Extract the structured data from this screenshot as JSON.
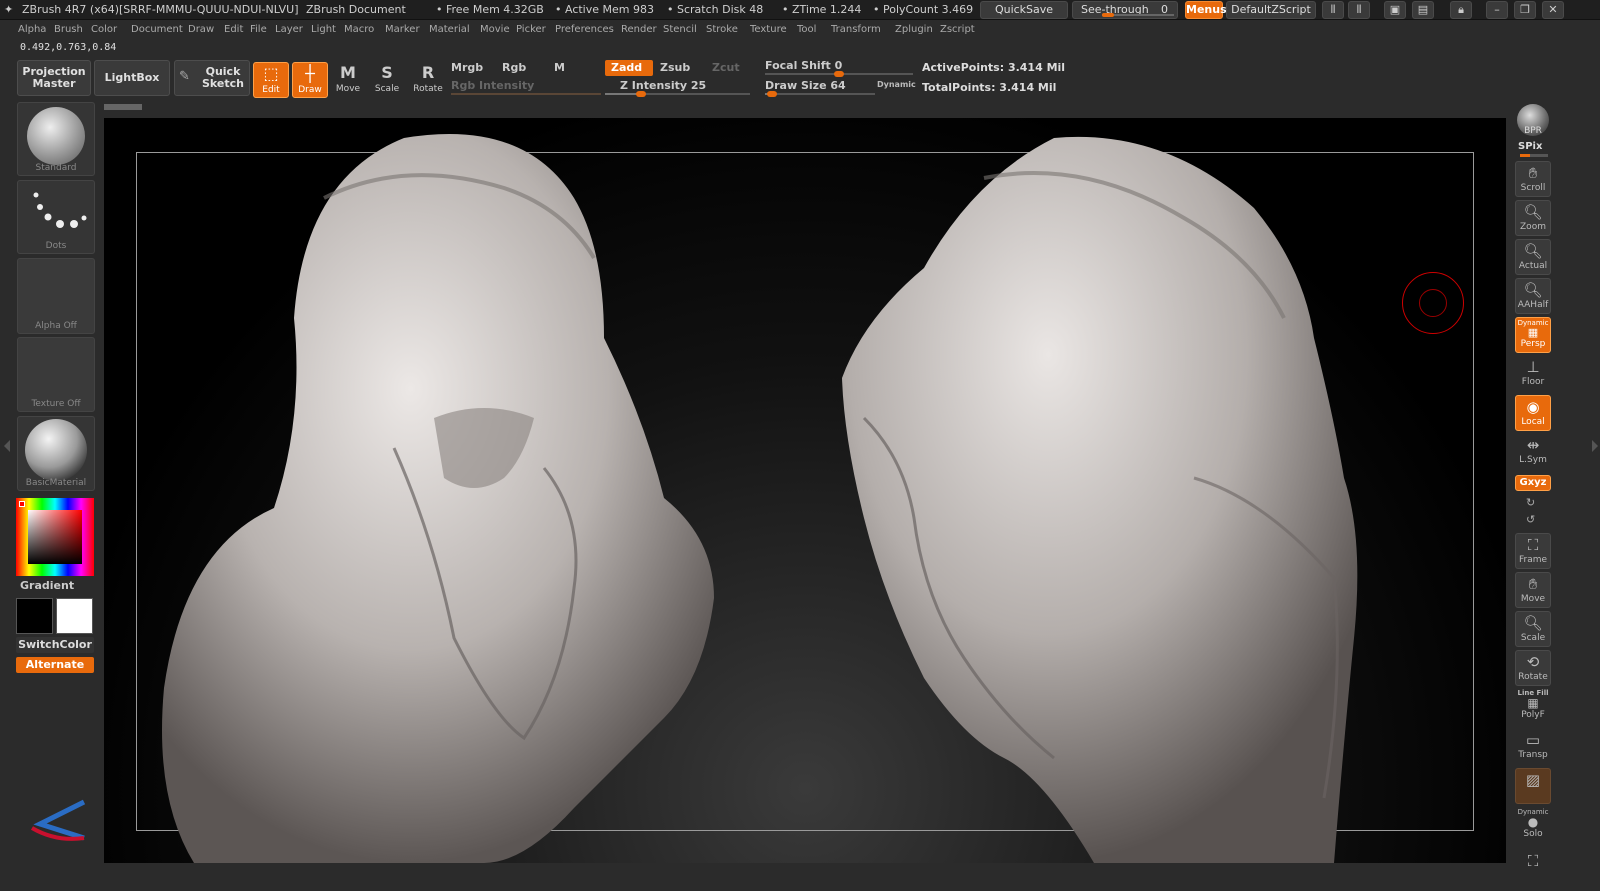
{
  "titlebar": {
    "app_title": "ZBrush 4R7 (x64)[SRRF-MMMU-QUUU-NDUI-NLVU]",
    "document": "ZBrush Document",
    "free_mem": "• Free Mem 4.32GB",
    "active_mem": "• Active Mem 983",
    "scratch": "• Scratch Disk 48",
    "ztime": "• ZTime 1.244",
    "polycount": "• PolyCount 3.469",
    "quicksave": "QuickSave",
    "see_through_label": "See-through",
    "see_through_value": "0",
    "see_through_level": 0,
    "menus": "Menus",
    "script": "DefaultZScript"
  },
  "menu": [
    "Alpha",
    "Brush",
    "Color",
    "Document",
    "Draw",
    "Edit",
    "File",
    "Layer",
    "Light",
    "Macro",
    "Marker",
    "Material",
    "Movie",
    "Picker",
    "Preferences",
    "Render",
    "Stencil",
    "Stroke",
    "Texture",
    "Tool",
    "Transform",
    "Zplugin",
    "Zscript"
  ],
  "coords": "0.492,0.763,0.84",
  "shelf": {
    "projection_master": [
      "Projection",
      "Master"
    ],
    "lightbox": "LightBox",
    "quick_sketch": [
      "Quick",
      "Sketch"
    ],
    "edit": "Edit",
    "draw": "Draw",
    "move": "Move",
    "scale": "Scale",
    "rotate": "Rotate",
    "mrgb": "Mrgb",
    "rgb": "Rgb",
    "m": "M",
    "rgb_intensity": "Rgb Intensity",
    "zadd": "Zadd",
    "zsub": "Zsub",
    "zcut": "Zcut",
    "z_intensity": "Z Intensity 25",
    "z_intensity_value": 25,
    "focal_shift": "Focal Shift 0",
    "focal_shift_value": 0,
    "draw_size": "Draw Size 64",
    "draw_size_value": 64,
    "dynamic": "Dynamic",
    "active_points": "ActivePoints: 3.414 Mil",
    "total_points": "TotalPoints: 3.414 Mil"
  },
  "left": {
    "brush": "Standard",
    "stroke": "Dots",
    "alpha": "Alpha  Off",
    "texture": "Texture  Off",
    "material": "BasicMaterial",
    "gradient": "Gradient",
    "switch_color": "SwitchColor",
    "alternate": "Alternate"
  },
  "right": {
    "bpr": "BPR",
    "spix": "SPix",
    "scroll": "Scroll",
    "zoom": "Zoom",
    "actual": "Actual",
    "aahalf": "AAHalf",
    "dynamic_small": "Dynamic",
    "persp": "Persp",
    "floor": "Floor",
    "local": "Local",
    "lsym": "L.Sym",
    "xyz": "Gxyz",
    "frame": "Frame",
    "move": "Move",
    "scale": "Scale",
    "rotate": "Rotate",
    "line_fill": "Line Fill",
    "polyf": "PolyF",
    "transp": "Transp",
    "dynamic_solo": "Dynamic",
    "solo": "Solo"
  },
  "colors": {
    "accent": "#e86a0c",
    "panel": "#2b2b2b",
    "canvas": "#000000"
  }
}
